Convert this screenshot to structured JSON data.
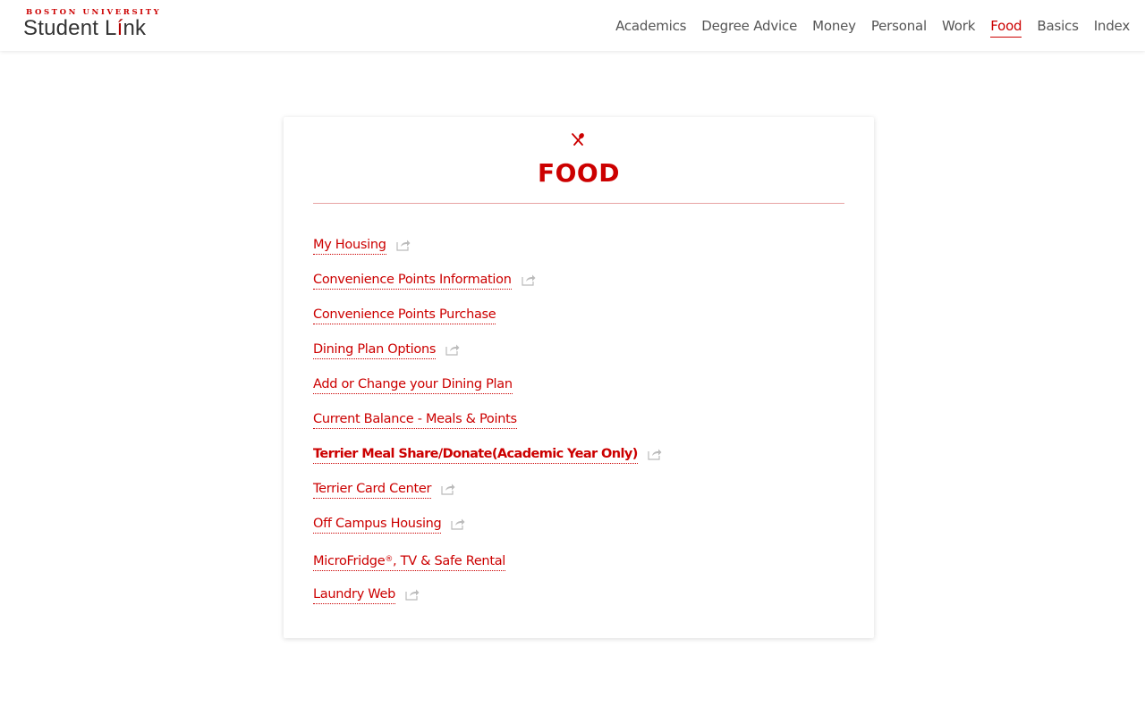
{
  "header": {
    "logo_top": "BOSTON UNIVERSITY",
    "logo_main_1": "Student L",
    "logo_main_accent": "í",
    "logo_main_2": "nk",
    "nav": [
      {
        "label": "Academics",
        "active": false
      },
      {
        "label": "Degree Advice",
        "active": false
      },
      {
        "label": "Money",
        "active": false
      },
      {
        "label": "Personal",
        "active": false
      },
      {
        "label": "Work",
        "active": false
      },
      {
        "label": "Food",
        "active": true
      },
      {
        "label": "Basics",
        "active": false
      },
      {
        "label": "Index",
        "active": false
      }
    ]
  },
  "card": {
    "icon": "fork-knife-icon",
    "title": "FOOD",
    "links": [
      {
        "label": "My Housing",
        "external": true
      },
      {
        "label": "Convenience Points Information",
        "external": true
      },
      {
        "label": "Convenience Points Purchase",
        "external": false
      },
      {
        "label": "Dining Plan Options",
        "external": true
      },
      {
        "label": "Add or Change your Dining Plan",
        "external": false
      },
      {
        "label": "Current Balance - Meals & Points",
        "external": false
      },
      {
        "label": "Terrier Meal Share/Donate(Academic Year Only)",
        "external": true,
        "bold": true
      },
      {
        "label": "Terrier Card Center",
        "external": true
      },
      {
        "label": "Off Campus Housing",
        "external": true
      },
      {
        "label_part1": "MicroFridge",
        "label_sup": "®",
        "label_part2": ", TV & Safe Rental",
        "external": false
      },
      {
        "label": "Laundry Web",
        "external": true
      }
    ]
  },
  "colors": {
    "accent": "#cc0000",
    "text": "#555555",
    "rule": "#e8a3a3"
  }
}
